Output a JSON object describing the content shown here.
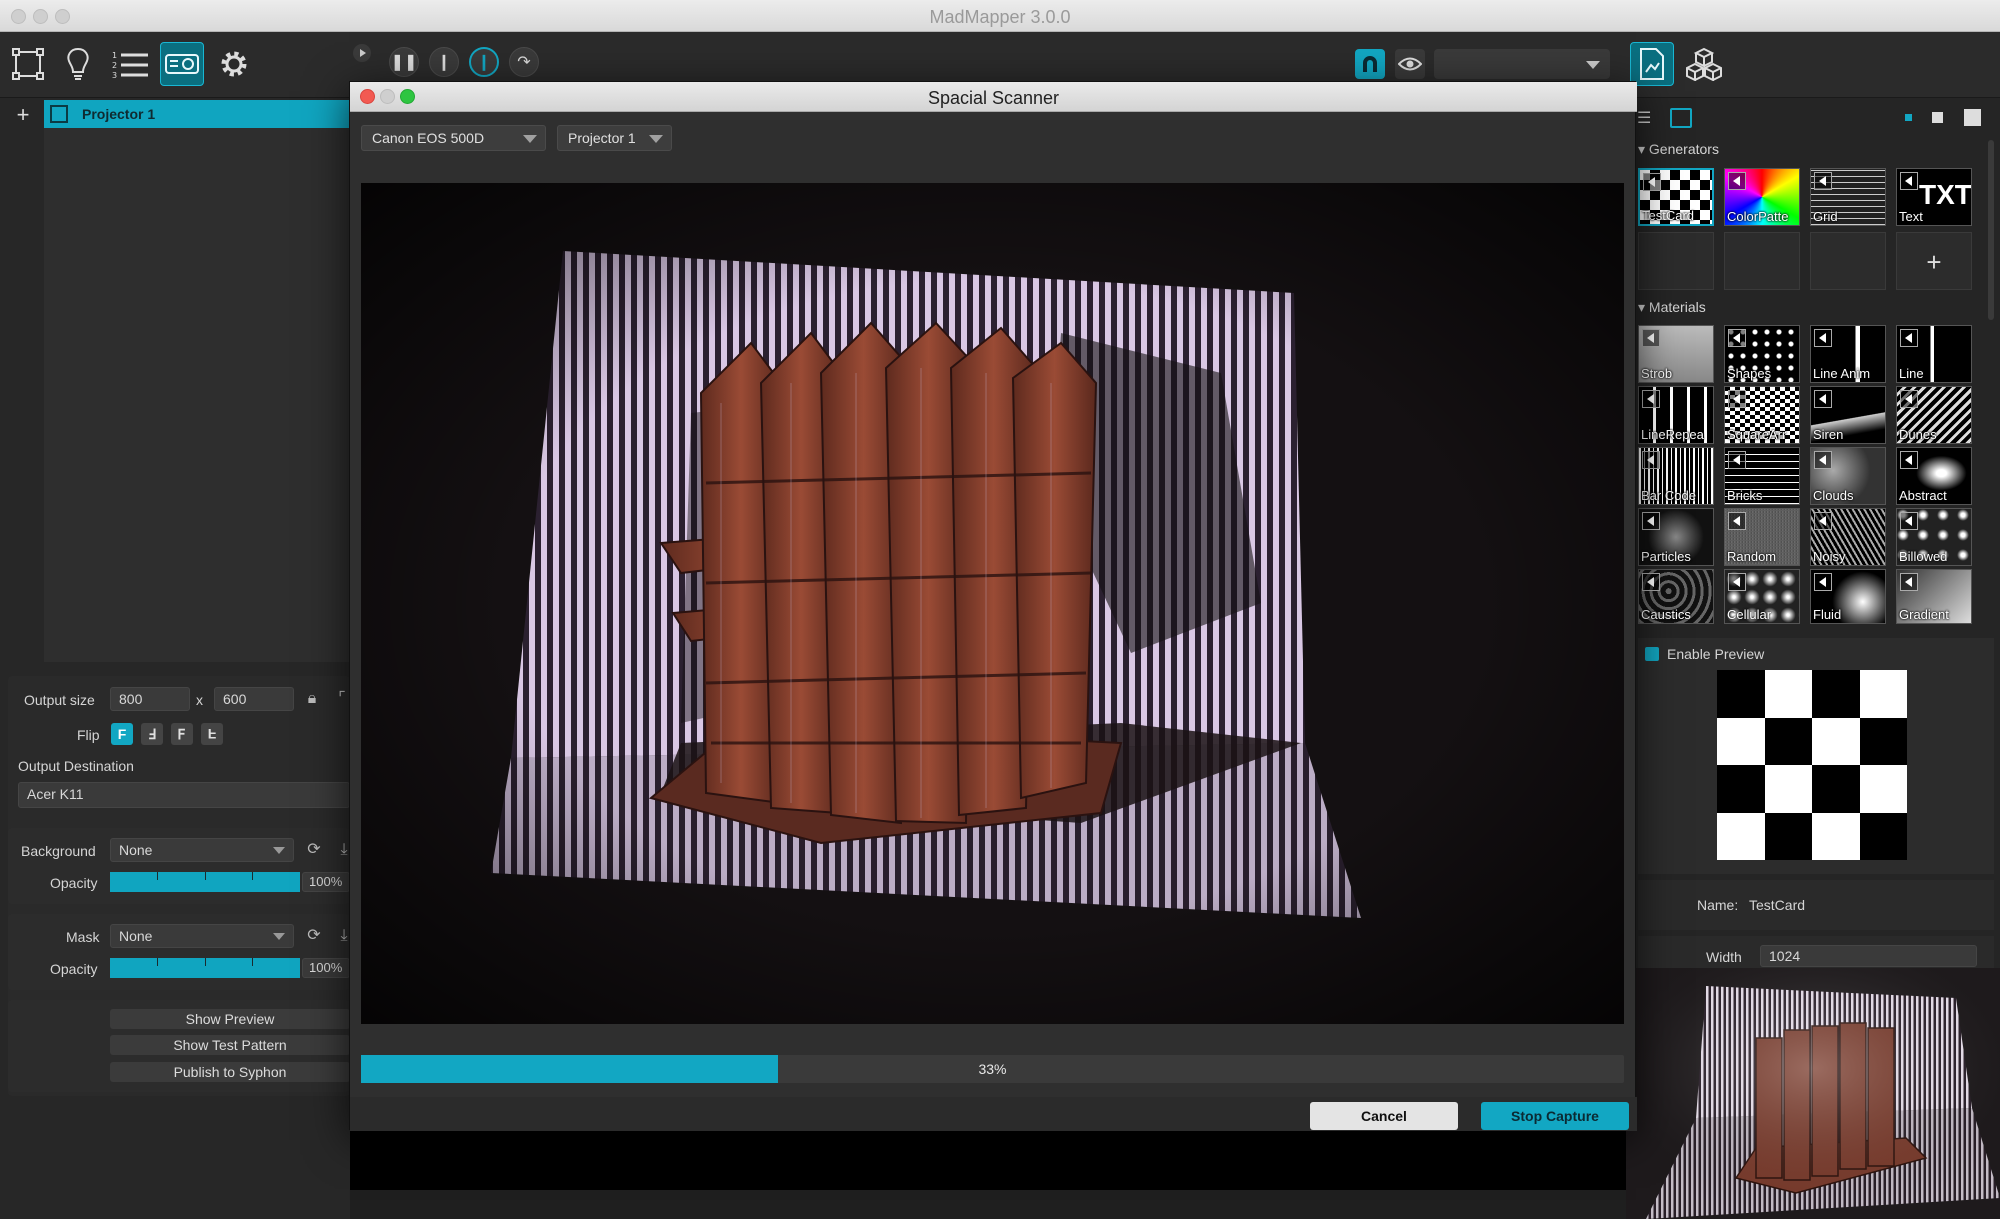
{
  "app": {
    "title": "MadMapper 3.0.0"
  },
  "toolbar": {
    "left_icons": [
      "surfaces-icon",
      "lightbulb-icon",
      "list-icon",
      "projector-icon",
      "gear-icon"
    ],
    "transport": [
      "pause-icon",
      "stop-icon",
      "power-icon",
      "redo-icon"
    ],
    "right_icons": [
      "magnet-icon",
      "eye-icon"
    ],
    "dropdown_value": ""
  },
  "projectors": {
    "items": [
      {
        "label": "Projector 1"
      }
    ]
  },
  "output": {
    "size_label": "Output size",
    "width": "800",
    "height": "600",
    "x_label": "x",
    "flip_label": "Flip",
    "flip_buttons": [
      "F",
      "Ⅎ",
      "Ⅎ",
      "F"
    ],
    "destination_label": "Output Destination",
    "destination_value": "Acer K11"
  },
  "background": {
    "label": "Background",
    "value": "None",
    "opacity_label": "Opacity",
    "opacity": "100%"
  },
  "mask": {
    "label": "Mask",
    "value": "None",
    "opacity_label": "Opacity",
    "opacity": "100%"
  },
  "buttons": {
    "show_preview": "Show Preview",
    "show_test_pattern": "Show Test Pattern",
    "publish_syphon": "Publish to Syphon"
  },
  "dialog": {
    "title": "Spacial Scanner",
    "camera": "Canon EOS 500D",
    "projector": "Projector 1",
    "progress_text": "33%",
    "progress_value": 0.33,
    "cancel": "Cancel",
    "stop_capture": "Stop Capture"
  },
  "library": {
    "generators_label": "Generators",
    "generators": [
      "TestCard",
      "ColorPatte",
      "Grid",
      "Text"
    ],
    "text_thumb_glyph": "TXT",
    "add_glyph": "+",
    "materials_label": "Materials",
    "materials": [
      "Strob",
      "Shapes",
      "Line Anim",
      "Line",
      "LineRepea",
      "SquareArr",
      "Siren",
      "Dunes",
      "Bar Code",
      "Bricks",
      "Clouds",
      "Abstract",
      "Particles",
      "Random",
      "Noisy",
      "Billowed",
      "Caustics",
      "Cellular",
      "Fluid",
      "Gradient"
    ]
  },
  "preview": {
    "enable_label": "Enable Preview",
    "name_label": "Name:",
    "name_value": "TestCard",
    "width_label": "Width",
    "width_value": "1024"
  },
  "colors": {
    "accent": "#12a7c3",
    "panel": "#272727",
    "dark": "#1f1f1f"
  }
}
